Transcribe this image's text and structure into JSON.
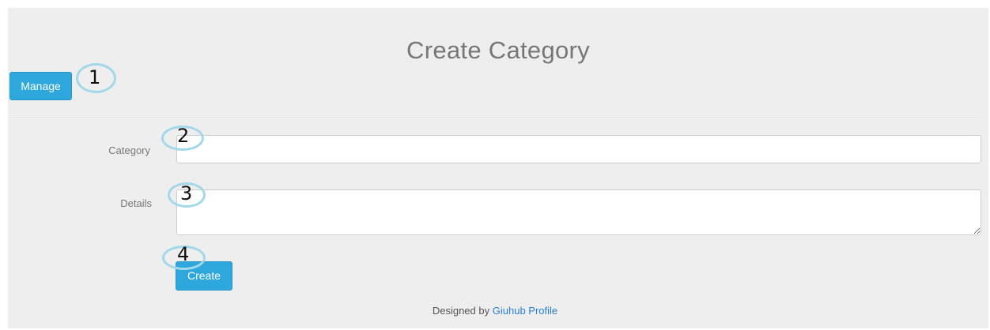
{
  "page": {
    "title": "Create Category"
  },
  "toolbar": {
    "manage_label": "Manage"
  },
  "form": {
    "category": {
      "label": "Category",
      "value": "",
      "placeholder": ""
    },
    "details": {
      "label": "Details",
      "value": "",
      "placeholder": ""
    },
    "create_label": "Create"
  },
  "footer": {
    "prefix": "Designed by",
    "link_text": "Giuhub Profile"
  },
  "annotations": {
    "markers": [
      "1",
      "2",
      "3",
      "4"
    ],
    "color": "#a3d8ea"
  },
  "colors": {
    "primary_button": "#2ea7dc",
    "panel_background": "#eeeeee",
    "link": "#2a7fd4"
  }
}
